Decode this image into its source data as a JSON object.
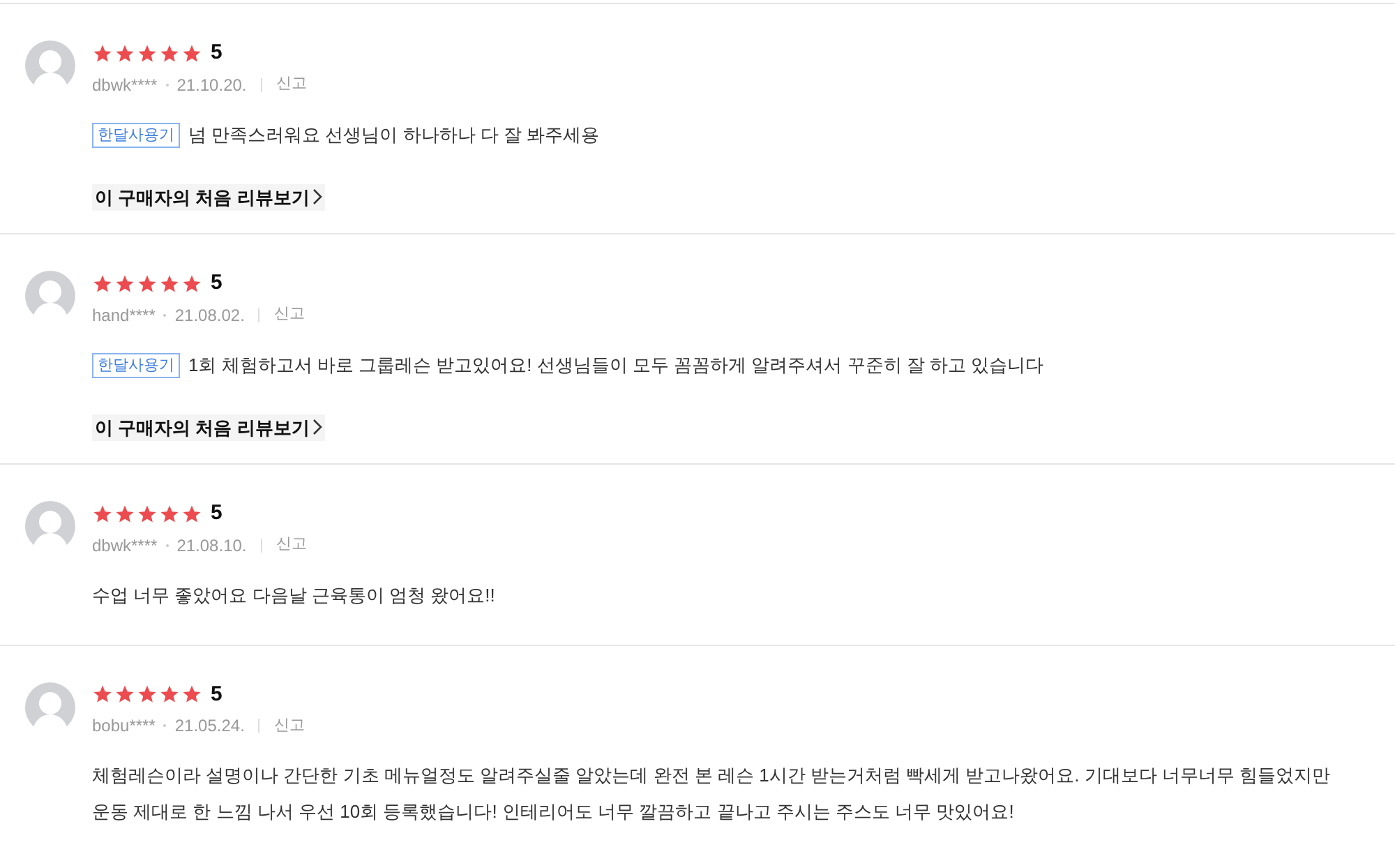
{
  "reviews": [
    {
      "stars": 5,
      "score": "5",
      "user": "dbwk****",
      "date": "21.10.20.",
      "report": "신고",
      "tag": "한달사용기",
      "text": "넘 만족스러워요 선생님이 하나하나 다 잘 봐주세용",
      "first_review_link": "이 구매자의 처음 리뷰보기"
    },
    {
      "stars": 5,
      "score": "5",
      "user": "hand****",
      "date": "21.08.02.",
      "report": "신고",
      "tag": "한달사용기",
      "text": "1회 체험하고서 바로 그룹레슨 받고있어요! 선생님들이 모두 꼼꼼하게 알려주셔서 꾸준히 잘 하고 있습니다",
      "first_review_link": "이 구매자의 처음 리뷰보기"
    },
    {
      "stars": 5,
      "score": "5",
      "user": "dbwk****",
      "date": "21.08.10.",
      "report": "신고",
      "text": "수업 너무 좋았어요 다음날 근육통이 엄청 왔어요!!"
    },
    {
      "stars": 5,
      "score": "5",
      "user": "bobu****",
      "date": "21.05.24.",
      "report": "신고",
      "text": "체험레슨이라 설명이나 간단한 기초 메뉴얼정도 알려주실줄 알았는데 완전 본 레슨 1시간 받는거처럼 빡세게 받고나왔어요. 기대보다 너무너무 힘들었지만 운동 제대로 한 느낌 나서 우선 10회 등록했습니다! 인테리어도 너무 깔끔하고 끝나고 주시는 주스도 너무 맛있어요!"
    }
  ]
}
